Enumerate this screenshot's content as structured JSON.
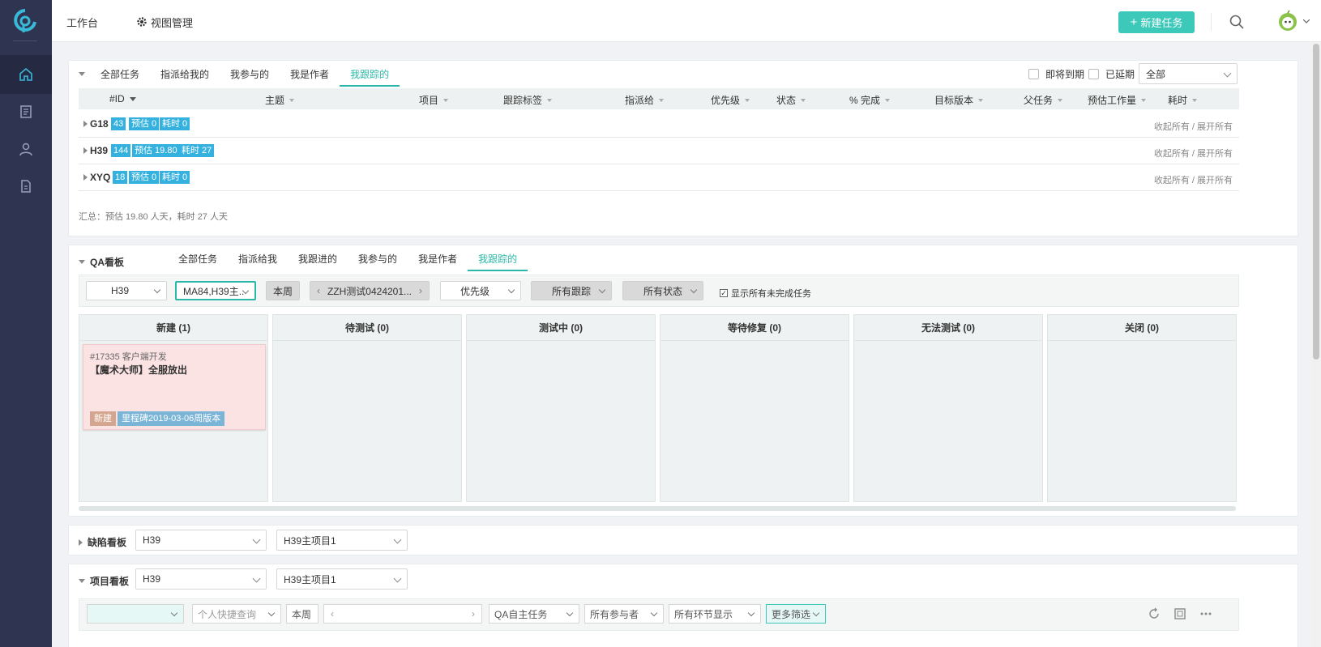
{
  "topbar": {
    "workbench": "工作台",
    "view_manage": "视图管理",
    "new_task": "新建任务"
  },
  "tasks": {
    "tabs": [
      "全部任务",
      "指派给我的",
      "我参与的",
      "我是作者",
      "我跟踪的"
    ],
    "active_tab": "我跟踪的",
    "due_soon": "即将到期",
    "overdue": "已延期",
    "scope_select": "全部",
    "columns": [
      "#ID",
      "主题",
      "项目",
      "跟踪标签",
      "指派给",
      "优先级",
      "状态",
      "% 完成",
      "目标版本",
      "父任务",
      "预估工作量",
      "耗时"
    ],
    "groups": [
      {
        "name": "G18",
        "count": "43",
        "estimate": "预估 0",
        "spent": "耗时 0"
      },
      {
        "name": "H39",
        "count": "144",
        "estimate": "预估 19.80",
        "spent": "耗时 27"
      },
      {
        "name": "XYQ",
        "count": "18",
        "estimate": "预估 0",
        "spent": "耗时 0"
      }
    ],
    "group_action": "收起所有 / 展开所有",
    "summary": "汇总：预估 19.80 人天，耗时 27 人天"
  },
  "qa": {
    "title": "QA看板",
    "tabs": [
      "全部任务",
      "指派给我",
      "我跟进的",
      "我参与的",
      "我是作者",
      "我跟踪的"
    ],
    "active_tab": "我跟踪的",
    "filters": {
      "project": "H39",
      "version": "MA84,H39主...",
      "week": "本周",
      "sprint": "ZZH测试0424201...",
      "priority": "优先级",
      "tracking": "所有跟踪",
      "status": "所有状态",
      "show_incomplete": "显示所有未完成任务"
    },
    "columns": [
      "新建 (1)",
      "待测试 (0)",
      "测试中 (0)",
      "等待修复 (0)",
      "无法测试 (0)",
      "关闭 (0)"
    ],
    "card": {
      "id": "#17335 客户端开发",
      "title": "【魔术大师】全服放出",
      "status": "新建",
      "milestone": "里程碑2019-03-06周版本"
    }
  },
  "defect": {
    "title": "缺陷看板",
    "project": "H39",
    "subproject": "H39主项目1"
  },
  "project_board": {
    "title": "项目看板",
    "project": "H39",
    "subproject": "H39主项目1",
    "filters": {
      "quick_query": "个人快捷查询",
      "week": "本周",
      "task_type": "QA自主任务",
      "participants": "所有参与者",
      "stages": "所有环节显示",
      "more": "更多筛选"
    }
  },
  "colors": {
    "sidebar": "#2f3551",
    "accent": "#3cc9b9",
    "tag_blue": "#35b1e0",
    "card_bg": "#fce3e3"
  }
}
